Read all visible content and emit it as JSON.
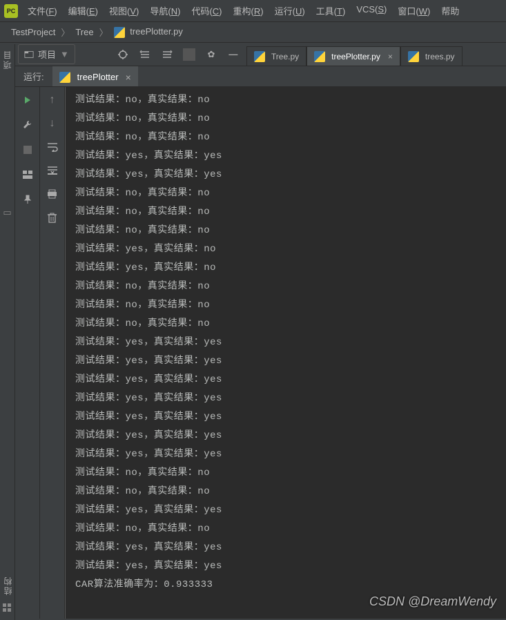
{
  "menu": {
    "items": [
      "文件(F)",
      "编辑(E)",
      "视图(V)",
      "导航(N)",
      "代码(C)",
      "重构(R)",
      "运行(U)",
      "工具(T)",
      "VCS(S)",
      "窗口(W)",
      "帮助"
    ]
  },
  "breadcrumb": {
    "root": "TestProject",
    "folder": "Tree",
    "file": "treePlotter.py"
  },
  "project_selector": "项目",
  "editor_tabs": [
    {
      "label": "Tree.py",
      "active": false
    },
    {
      "label": "treePlotter.py",
      "active": true
    },
    {
      "label": "trees.py",
      "active": false
    }
  ],
  "sidebar": {
    "project": "项目",
    "structure": "结构"
  },
  "run": {
    "label": "运行:",
    "tab": "treePlotter"
  },
  "console_lines": [
    "测试结果：no，真实结果：no",
    "测试结果：no，真实结果：no",
    "测试结果：no，真实结果：no",
    "测试结果：yes，真实结果：yes",
    "测试结果：yes，真实结果：yes",
    "测试结果：no，真实结果：no",
    "测试结果：no，真实结果：no",
    "测试结果：no，真实结果：no",
    "测试结果：yes，真实结果：no",
    "测试结果：yes，真实结果：no",
    "测试结果：no，真实结果：no",
    "测试结果：no，真实结果：no",
    "测试结果：no，真实结果：no",
    "测试结果：yes，真实结果：yes",
    "测试结果：yes，真实结果：yes",
    "测试结果：yes，真实结果：yes",
    "测试结果：yes，真实结果：yes",
    "测试结果：yes，真实结果：yes",
    "测试结果：yes，真实结果：yes",
    "测试结果：yes，真实结果：yes",
    "测试结果：no，真实结果：no",
    "测试结果：no，真实结果：no",
    "测试结果：yes，真实结果：yes",
    "测试结果：no，真实结果：no",
    "测试结果：yes，真实结果：yes",
    "测试结果：yes，真实结果：yes",
    "CAR算法准确率为：0.933333"
  ],
  "watermark": "CSDN @DreamWendy"
}
